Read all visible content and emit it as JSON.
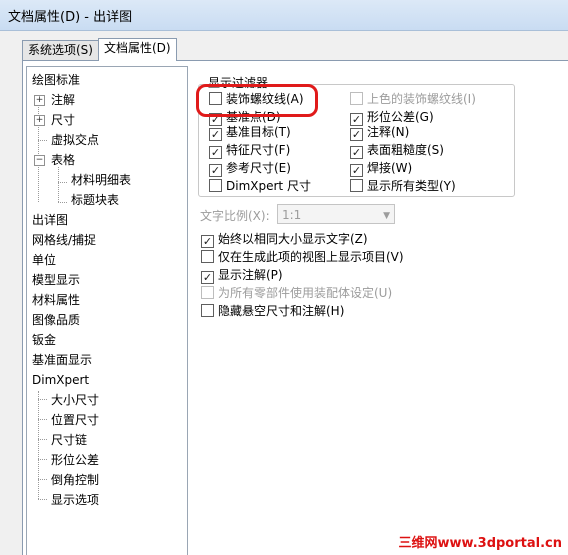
{
  "window": {
    "title": "文档属性(D) - 出详图"
  },
  "tabs": [
    {
      "label": "系统选项(S)",
      "active": false
    },
    {
      "label": "文档属性(D)",
      "active": true
    }
  ],
  "tree": {
    "items": [
      {
        "label": "绘图标准"
      },
      {
        "label": "注解",
        "expander": "+"
      },
      {
        "label": "尺寸",
        "expander": "+"
      },
      {
        "label": "虚拟交点"
      },
      {
        "label": "表格",
        "expander": "-"
      },
      {
        "label": "材料明细表"
      },
      {
        "label": "标题块表"
      },
      {
        "label": "出详图",
        "selected": true
      },
      {
        "label": "网格线/捕捉"
      },
      {
        "label": "单位"
      },
      {
        "label": "模型显示"
      },
      {
        "label": "材料属性"
      },
      {
        "label": "图像品质"
      },
      {
        "label": "钣金"
      },
      {
        "label": "基准面显示"
      },
      {
        "label": "DimXpert"
      },
      {
        "label": "大小尺寸"
      },
      {
        "label": "位置尺寸"
      },
      {
        "label": "尺寸链"
      },
      {
        "label": "形位公差"
      },
      {
        "label": "倒角控制"
      },
      {
        "label": "显示选项"
      }
    ]
  },
  "display_filter": {
    "title": "显示过滤器",
    "left": [
      {
        "label": "装饰螺纹线(A)",
        "checked": false,
        "enabled": true
      },
      {
        "label": "基准点(D)",
        "checked": true,
        "enabled": true
      },
      {
        "label": "基准目标(T)",
        "checked": true,
        "enabled": true
      },
      {
        "label": "特征尺寸(F)",
        "checked": true,
        "enabled": true
      },
      {
        "label": "参考尺寸(E)",
        "checked": true,
        "enabled": true
      },
      {
        "label": "DimXpert 尺寸",
        "checked": false,
        "enabled": true
      }
    ],
    "right": [
      {
        "label": "上色的装饰螺纹线(I)",
        "checked": false,
        "enabled": false
      },
      {
        "label": "形位公差(G)",
        "checked": true,
        "enabled": true
      },
      {
        "label": "注释(N)",
        "checked": true,
        "enabled": true
      },
      {
        "label": "表面粗糙度(S)",
        "checked": true,
        "enabled": true
      },
      {
        "label": "焊接(W)",
        "checked": true,
        "enabled": true
      },
      {
        "label": "显示所有类型(Y)",
        "checked": false,
        "enabled": true
      }
    ]
  },
  "text_scale": {
    "label": "文字比例(X):",
    "value": "1:1",
    "enabled": false
  },
  "options": [
    {
      "label": "始终以相同大小显示文字(Z)",
      "checked": true,
      "enabled": true
    },
    {
      "label": "仅在生成此项的视图上显示项目(V)",
      "checked": false,
      "enabled": true
    },
    {
      "label": "显示注解(P)",
      "checked": true,
      "enabled": true
    },
    {
      "label": "为所有零部件使用装配体设定(U)",
      "checked": false,
      "enabled": false
    },
    {
      "label": "隐藏悬空尺寸和注解(H)",
      "checked": false,
      "enabled": true
    }
  ],
  "watermark": "三维网www.3dportal.cn",
  "colors": {
    "highlight": "#e01a1a",
    "watermark": "#d11111"
  }
}
